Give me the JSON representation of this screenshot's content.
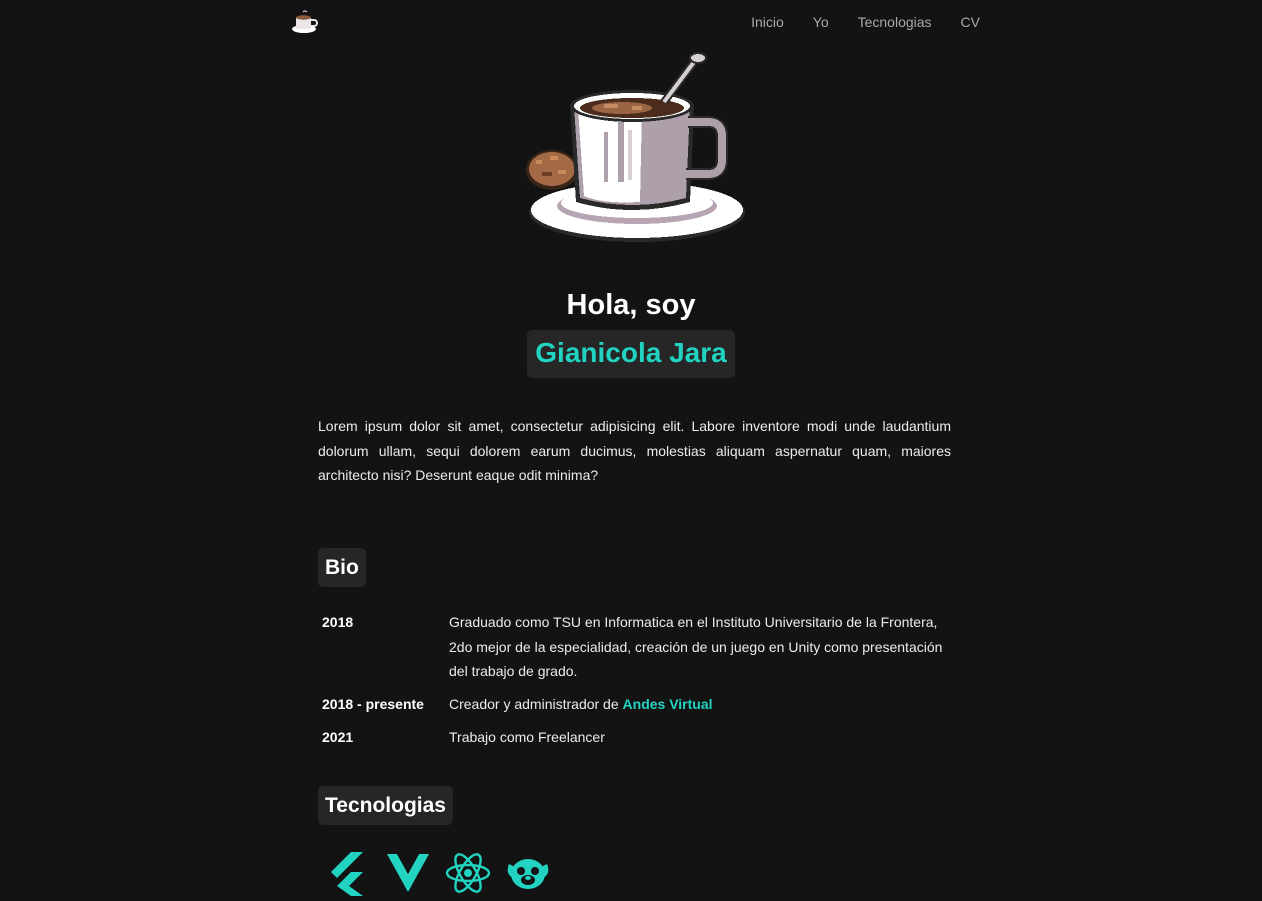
{
  "nav": {
    "logo_icon": "coffee-cup-icon",
    "links": [
      "Inicio",
      "Yo",
      "Tecnologias",
      "CV"
    ]
  },
  "hero": {
    "image_icon": "pixel-coffee-cup-illustration",
    "greeting": "Hola, soy",
    "name": "Gianicola Jara",
    "intro": "Lorem ipsum dolor sit amet, consectetur adipisicing elit. Labore inventore modi unde laudantium dolorum ullam, sequi dolorem earum ducimus, molestias aliquam aspernatur quam, maiores architecto nisi? Deserunt eaque odit minima?"
  },
  "bio": {
    "title": "Bio",
    "items": [
      {
        "year": "2018",
        "text": "Graduado como TSU en Informatica en el Instituto Universitario de la Frontera, 2do mejor de la especialidad, creación de un juego en Unity como presentación del trabajo de grado."
      },
      {
        "year": "2018 - presente",
        "text": "Creador y administrador de ",
        "link": "Andes Virtual"
      },
      {
        "year": "2021",
        "text": "Trabajo como Freelancer"
      }
    ]
  },
  "tech": {
    "title": "Tecnologias",
    "icons": [
      "flutter-icon",
      "vue-icon",
      "react-icon",
      "pug-icon"
    ]
  },
  "colors": {
    "background": "#131313",
    "accent": "#21d3c0",
    "chip": "#262626",
    "nav_text": "#a9a9a9"
  }
}
